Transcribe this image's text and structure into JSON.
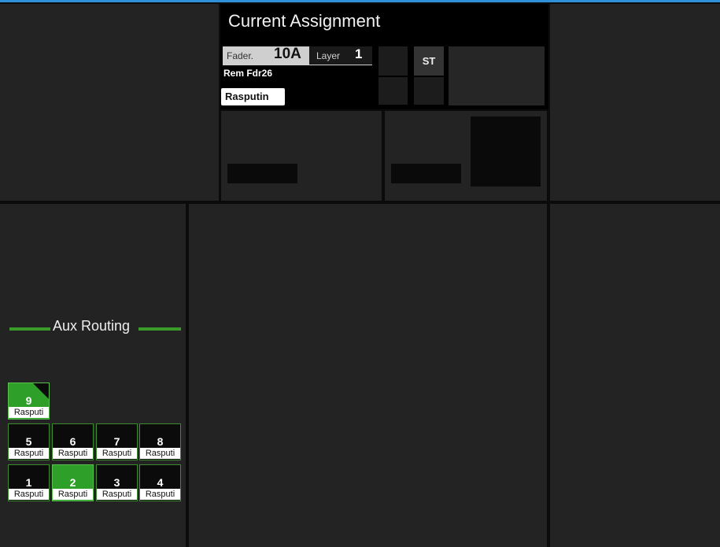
{
  "header": {
    "title": "Current Assignment",
    "fader_label": "Fader.",
    "fader_value": "10A",
    "layer_label": "Layer",
    "layer_value": "1",
    "remote_name": "Rem Fdr26",
    "channel_name": "Rasputin",
    "st_button": "ST"
  },
  "aux_routing": {
    "title": "Aux Routing",
    "buttons": [
      {
        "number": "9",
        "label": "Rasputi",
        "active": true
      },
      {
        "number": "5",
        "label": "Rasputi",
        "active": false
      },
      {
        "number": "6",
        "label": "Rasputi",
        "active": false
      },
      {
        "number": "7",
        "label": "Rasputi",
        "active": false
      },
      {
        "number": "8",
        "label": "Rasputi",
        "active": false
      },
      {
        "number": "1",
        "label": "Rasputi",
        "active": false
      },
      {
        "number": "2",
        "label": "Rasputi",
        "active": true
      },
      {
        "number": "3",
        "label": "Rasputi",
        "active": false
      },
      {
        "number": "4",
        "label": "Rasputi",
        "active": false
      }
    ]
  },
  "colors": {
    "accent_green": "#2ea02a",
    "top_line": "#2f8fd8",
    "panel": "#232323"
  }
}
